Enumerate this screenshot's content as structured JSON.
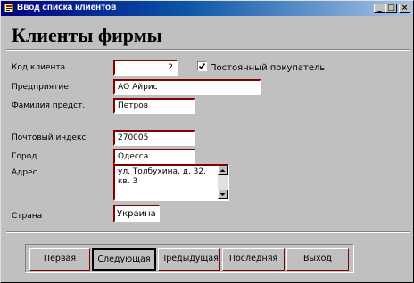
{
  "window": {
    "title": "Ввод списка клиентов",
    "minimize_glyph": "_",
    "maximize_glyph": "□",
    "close_glyph": "×"
  },
  "heading": "Клиенты фирмы",
  "form": {
    "client_code": {
      "label": "Код клиента",
      "value": "2"
    },
    "regular_customer": {
      "label": "Постоянный покупатель",
      "checked": true
    },
    "company": {
      "label": "Предприятие",
      "value": "АО Айрис"
    },
    "representative": {
      "label": "Фамилия предст.",
      "value": "Петров"
    },
    "postal_code": {
      "label": "Почтовый индекс",
      "value": "270005"
    },
    "city": {
      "label": "Город",
      "value": "Одесса"
    },
    "address": {
      "label": "Адрес",
      "value": "ул. Толбухина, д. 32, кв. 3"
    },
    "country": {
      "label": "Страна",
      "value": "Украина"
    }
  },
  "nav_buttons": {
    "first": "Первая",
    "next": "Следующая",
    "previous": "Предыдущая",
    "last": "Последняя",
    "exit": "Выход"
  },
  "colors": {
    "titlebar_start": "#000080",
    "titlebar_end": "#a8c4e8",
    "window_bg": "#c0c0c0",
    "field_accent": "#800000"
  },
  "icons": {
    "app": "app-form-icon",
    "checkbox": "checkmark-icon",
    "scroll_up": "arrow-up-icon",
    "scroll_down": "arrow-down-icon"
  }
}
